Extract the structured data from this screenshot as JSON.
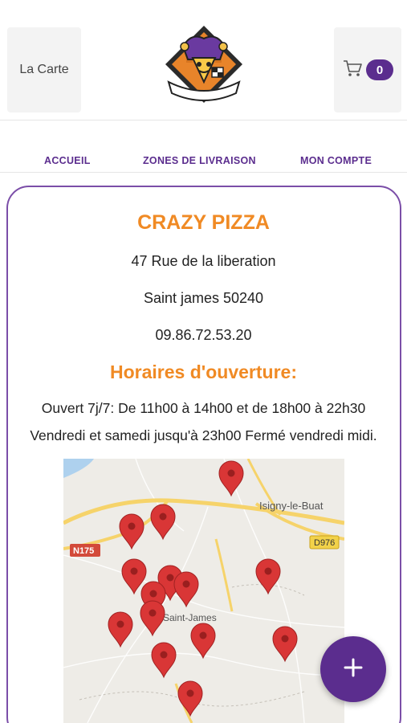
{
  "header": {
    "menu_label": "La Carte",
    "cart_count": "0",
    "logo_text": "CRAZY PIZZA"
  },
  "nav": {
    "items": [
      {
        "label": "ACCUEIL"
      },
      {
        "label": "ZONES DE LIVRAISON"
      },
      {
        "label": "MON COMPTE"
      }
    ]
  },
  "restaurant": {
    "name": "CRAZY PIZZA",
    "address": "47 Rue de la liberation",
    "city": "Saint james 50240",
    "phone": "09.86.72.53.20"
  },
  "hours": {
    "title": "Horaires d'ouverture:",
    "line1": "Ouvert 7j/7: De 11h00 à 14h00 et de 18h00 à 22h30",
    "line2": "Vendredi et samedi jusqu'à 23h00 Fermé vendredi midi."
  },
  "map": {
    "labels": {
      "town1": "Isigny-le-Buat",
      "town2": "Saint-James",
      "road1": "N175",
      "road2": "D976"
    },
    "marker_color": "#d93636"
  },
  "colors": {
    "accent": "#5b2d8e",
    "title": "#f08a24"
  },
  "fab": {
    "icon": "plus-icon"
  }
}
